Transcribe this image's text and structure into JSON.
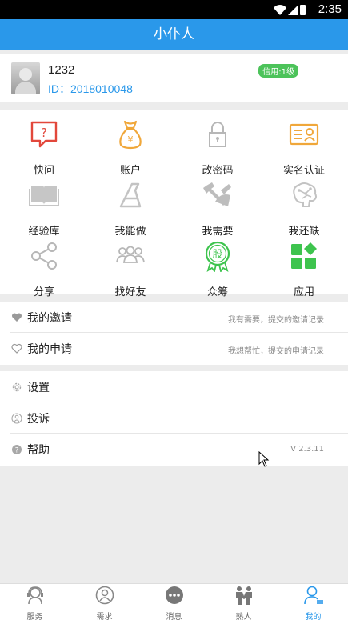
{
  "status": {
    "time": "2:35"
  },
  "app": {
    "title": "小仆人"
  },
  "profile": {
    "name": "1232",
    "id_text": "ID：2018010048",
    "credit_badge": "信用:1级"
  },
  "grid": [
    {
      "label": "快问",
      "icon": "question-message-icon"
    },
    {
      "label": "账户",
      "icon": "money-bag-icon"
    },
    {
      "label": "改密码",
      "icon": "lock-icon"
    },
    {
      "label": "实名认证",
      "icon": "id-card-icon"
    },
    {
      "label": "经验库",
      "icon": "book-icon"
    },
    {
      "label": "我能做",
      "icon": "skill-icon"
    },
    {
      "label": "我需要",
      "icon": "tools-icon"
    },
    {
      "label": "我还缺",
      "icon": "brain-icon"
    },
    {
      "label": "分享",
      "icon": "share-icon"
    },
    {
      "label": "找好友",
      "icon": "friends-icon"
    },
    {
      "label": "众筹",
      "icon": "crowdfunding-badge-icon"
    },
    {
      "label": "应用",
      "icon": "apps-icon"
    }
  ],
  "list1": [
    {
      "label": "我的邀请",
      "hint": "我有需要，提交的邀请记录",
      "icon": "heart-filled-icon"
    },
    {
      "label": "我的申请",
      "hint": "我想帮忙，提交的申请记录",
      "icon": "heart-outline-icon"
    }
  ],
  "list2": [
    {
      "label": "设置",
      "hint": "",
      "icon": "gear-icon"
    },
    {
      "label": "投诉",
      "hint": "",
      "icon": "complaint-icon"
    },
    {
      "label": "帮助",
      "hint": "V 2.3.11",
      "icon": "help-icon"
    }
  ],
  "tabs": [
    {
      "label": "服务",
      "icon": "service-icon",
      "active": false
    },
    {
      "label": "需求",
      "icon": "demand-icon",
      "active": false
    },
    {
      "label": "消息",
      "icon": "message-icon",
      "active": false
    },
    {
      "label": "熟人",
      "icon": "acquaintance-icon",
      "active": false
    },
    {
      "label": "我的",
      "icon": "profile-icon",
      "active": true
    }
  ],
  "colors": {
    "primary": "#2a98ea",
    "badge": "#4cc35a",
    "red_icon": "#e2473b",
    "orange_icon": "#f0a73a",
    "green_icon": "#3ec44e",
    "gray_icon": "#b7b7b7"
  }
}
